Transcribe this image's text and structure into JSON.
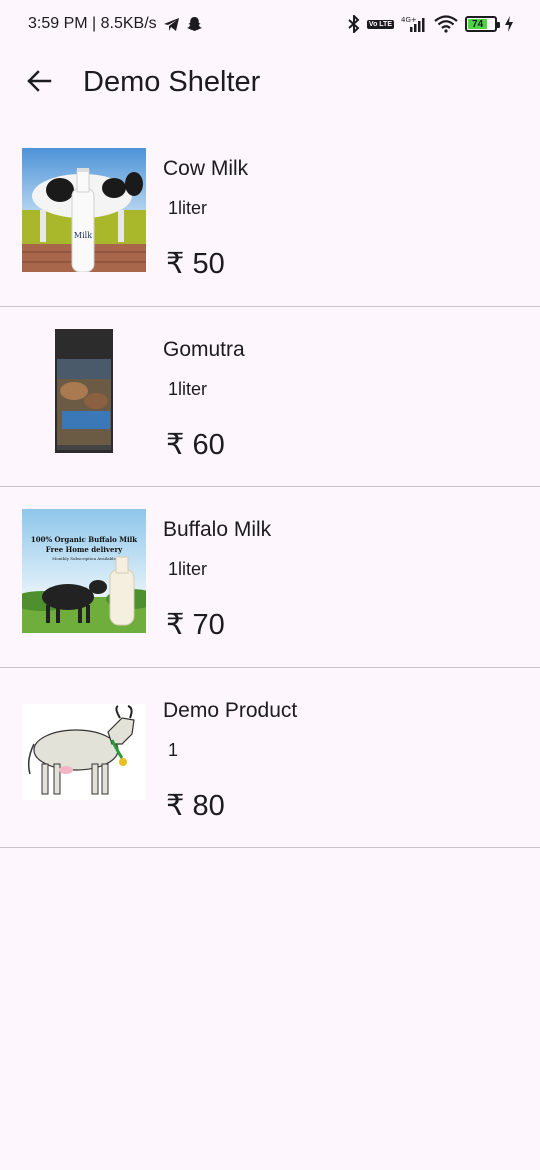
{
  "status_bar": {
    "time_speed": "3:59 PM | 8.5KB/s",
    "network": "4G+",
    "volte": "Vo LTE",
    "battery": "74"
  },
  "app_bar": {
    "title": "Demo Shelter",
    "back_icon": "arrow-back-icon"
  },
  "products": [
    {
      "name": "Cow Milk",
      "quantity": "1liter",
      "price": "₹ 50",
      "image": "cow-milk-image"
    },
    {
      "name": "Gomutra",
      "quantity": "1liter",
      "price": "₹ 60",
      "image": "gomutra-image"
    },
    {
      "name": "Buffalo Milk",
      "quantity": "1liter",
      "price": "₹ 70",
      "image": "buffalo-milk-image",
      "image_text": {
        "line1": "100% Organic Buffalo  Milk",
        "line2": "Free Home delivery",
        "line3": "Monthly Subscription Available"
      }
    },
    {
      "name": "Demo Product",
      "quantity": "1",
      "price": "₹ 80",
      "image": "cow-illustration-image"
    }
  ],
  "colors": {
    "background": "#fdf7fd",
    "divider": "#c8c4ca",
    "text": "#1c1b1f",
    "battery": "#4cd442"
  }
}
